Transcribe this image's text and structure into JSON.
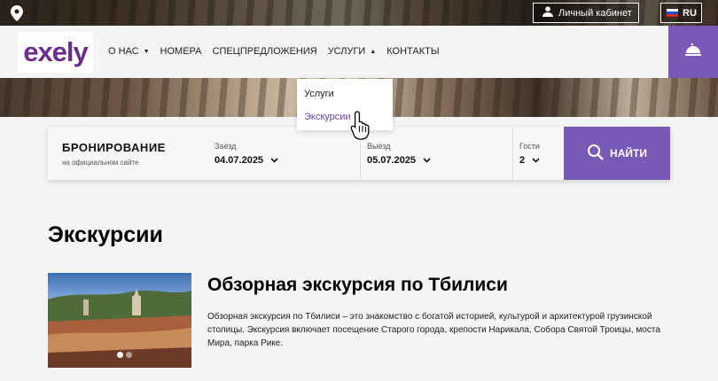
{
  "header": {
    "cabinet_label": "Личный кабинет",
    "lang_label": "RU",
    "pin_icon": "map-pin-icon",
    "user_icon": "user-icon",
    "bell_icon": "bell-icon"
  },
  "logo": {
    "text": "exely"
  },
  "nav": {
    "items": [
      {
        "label": "О НАС",
        "has_caret": true
      },
      {
        "label": "НОМЕРА"
      },
      {
        "label": "СПЕЦПРЕДЛОЖЕНИЯ"
      },
      {
        "label": "УСЛУГИ",
        "has_caret": true
      },
      {
        "label": "КОНТАКТЫ"
      }
    ]
  },
  "dropdown": {
    "items": [
      {
        "label": "Услуги"
      },
      {
        "label": "Экскурсии",
        "active": true
      }
    ]
  },
  "booking": {
    "title": "БРОНИРОВАНИЕ",
    "subtitle": "на официальном сайте",
    "checkin_label": "Заезд",
    "checkin_value": "04.07.2025",
    "checkout_label": "Выезд",
    "checkout_value": "05.07.2025",
    "guests_label": "Гости",
    "guests_value": "2",
    "search_label": "НАЙТИ"
  },
  "page": {
    "title": "Экскурсии"
  },
  "card": {
    "title": "Обзорная экскурсия по Тбилиси",
    "description": "Обзорная экскурсия по Тбилиси – это знакомство с богатой историей, культурой и архитектурой грузинской столицы. Экскурсия включает посещение Старого города, крепости Нарикала, Собора Святой Троицы, моста Мира, парка Рике."
  },
  "colors": {
    "accent": "#7a58b6",
    "logo": "#6b2c8c",
    "link_active": "#6b43a8"
  }
}
